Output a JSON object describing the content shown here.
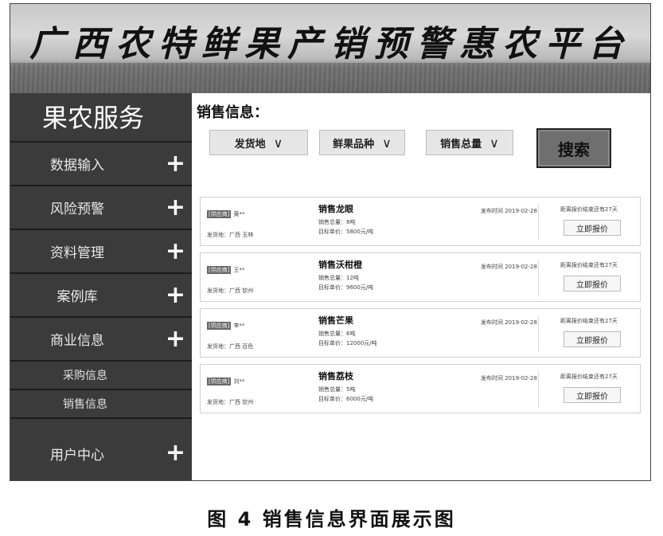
{
  "banner": {
    "title": "广西农特鲜果产销预警惠农平台"
  },
  "sidebar": {
    "brand": "果农服务",
    "items": [
      {
        "label": "数据输入",
        "plus": "+"
      },
      {
        "label": "风险预警",
        "plus": "+"
      },
      {
        "label": "资料管理",
        "plus": "+"
      },
      {
        "label": "案例库",
        "plus": "+"
      },
      {
        "label": "商业信息",
        "plus": "+"
      }
    ],
    "subitems": [
      {
        "label": "采购信息"
      },
      {
        "label": "销售信息"
      }
    ],
    "user": {
      "label": "用户中心",
      "plus": "+"
    }
  },
  "main": {
    "section_title": "销售信息：",
    "filters": [
      {
        "label": "发货地",
        "chevron": "∨"
      },
      {
        "label": "鲜果品种",
        "chevron": "∨"
      },
      {
        "label": "销售总量",
        "chevron": "∨"
      }
    ],
    "search_label": "搜索",
    "listings": [
      {
        "tag": "[供应商]",
        "name": "黄**",
        "origin": "发货地：广西 玉林",
        "title": "销售龙眼",
        "quantity": "销售总量：8吨",
        "price": "目标单价：5800元/吨",
        "date": "发布时间 2019-02-28",
        "expire": "距离报价结束还有27天",
        "quote": "立即报价"
      },
      {
        "tag": "[供应商]",
        "name": "王**",
        "origin": "发货地：广西 钦州",
        "title": "销售沃柑橙",
        "quantity": "销售总量：12吨",
        "price": "目标单价：9600元/吨",
        "date": "发布时间 2019-02-28",
        "expire": "距离报价结束还有27天",
        "quote": "立即报价"
      },
      {
        "tag": "[供应商]",
        "name": "李**",
        "origin": "发货地：广西 百色",
        "title": "销售芒果",
        "quantity": "销售总量：6吨",
        "price": "目标单价：12000元/吨",
        "date": "发布时间 2019-02-28",
        "expire": "距离报价结束还有27天",
        "quote": "立即报价"
      },
      {
        "tag": "[供应商]",
        "name": "刘**",
        "origin": "发货地：广西 钦州",
        "title": "销售荔枝",
        "quantity": "销售总量：5吨",
        "price": "目标单价：6000元/吨",
        "date": "发布时间 2019-02-28",
        "expire": "距离报价结束还有27天",
        "quote": "立即报价"
      }
    ]
  },
  "caption": "图 4   销售信息界面展示图"
}
